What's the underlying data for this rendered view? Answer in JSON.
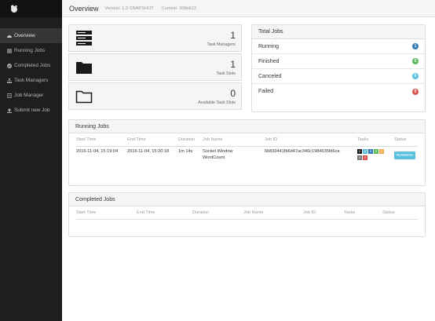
{
  "topbar": {
    "title": "Overview",
    "version": "Version: 1.2-SNAPSHOT",
    "commit": "Commit: 368b813"
  },
  "sidebar": {
    "items": [
      {
        "label": "Overview",
        "icon": "dashboard-icon"
      },
      {
        "label": "Running Jobs",
        "icon": "list-icon"
      },
      {
        "label": "Completed Jobs",
        "icon": "check-circle-icon"
      },
      {
        "label": "Task Managers",
        "icon": "sitemap-icon"
      },
      {
        "label": "Job Manager",
        "icon": "building-icon"
      },
      {
        "label": "Submit new Job",
        "icon": "upload-icon"
      }
    ]
  },
  "stats": [
    {
      "value": "1",
      "label": "Task Managers"
    },
    {
      "value": "1",
      "label": "Task Slots"
    },
    {
      "value": "0",
      "label": "Available Task Slots"
    }
  ],
  "totals": {
    "title": "Total Jobs",
    "rows": [
      {
        "label": "Running",
        "count": "1",
        "color": "#337ab7"
      },
      {
        "label": "Finished",
        "count": "0",
        "color": "#5cb85c"
      },
      {
        "label": "Canceled",
        "count": "0",
        "color": "#5bc0de"
      },
      {
        "label": "Failed",
        "count": "0",
        "color": "#d9534f"
      }
    ]
  },
  "running_jobs": {
    "title": "Running Jobs",
    "columns": [
      "Start Time",
      "End Time",
      "Duration",
      "Job Name",
      "Job ID",
      "Tasks",
      "Status"
    ],
    "rows": [
      {
        "start": "2016-11-04, 15:19:04",
        "end": "2016-11-04, 15:20:18",
        "duration": "1m 14s",
        "name": "Socket Window WordCount",
        "id": "6b830441fb6d47ac340c1984635fd6ca",
        "tasks": [
          "2",
          "0",
          "0",
          "0",
          "0",
          "0",
          "0"
        ],
        "status": "RUNNING"
      }
    ]
  },
  "completed_jobs": {
    "title": "Completed Jobs",
    "columns": [
      "Start Time",
      "End Time",
      "Duration",
      "Job Name",
      "Job ID",
      "Tasks",
      "Status"
    ]
  }
}
